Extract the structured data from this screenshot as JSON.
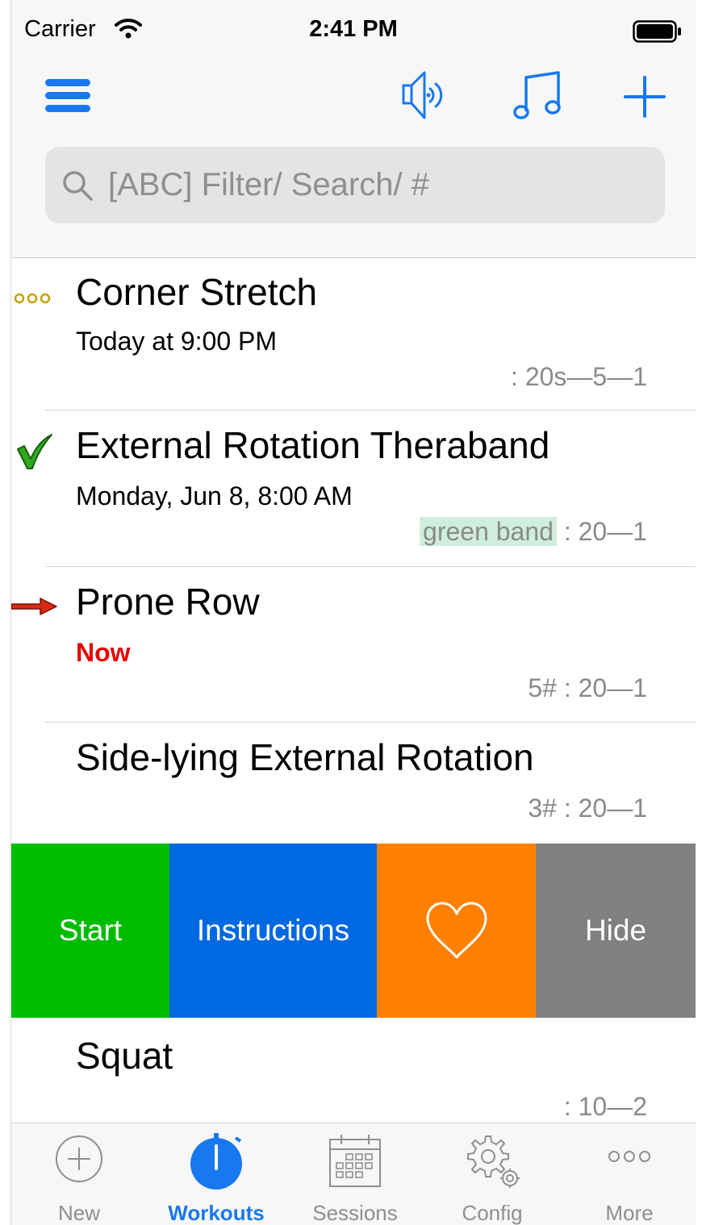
{
  "status_bar": {
    "carrier": "Carrier",
    "time": "2:41 PM"
  },
  "toolbar": {
    "menu_icon": "hamburger-menu-icon",
    "speaker_icon": "speaker-icon",
    "music_icon": "music-note-icon",
    "add_icon": "plus-icon"
  },
  "search": {
    "placeholder": "[ABC] Filter/ Search/ #",
    "value": ""
  },
  "workouts": [
    {
      "title": "Corner Stretch",
      "subtitle": "Today at 9:00 PM",
      "tag": "",
      "meta": ": 20s—5—1",
      "marker": "three-dots-icon"
    },
    {
      "title": "External Rotation Theraband",
      "subtitle": "Monday, Jun 8, 8:00 AM",
      "tag": "green band",
      "meta": " : 20—1",
      "marker": "checkmark-icon"
    },
    {
      "title": "Prone Row",
      "subtitle": "Now",
      "tag": "",
      "meta": "5# : 20—1",
      "marker": "arrow-right-icon"
    },
    {
      "title": "Side-lying External Rotation",
      "subtitle": "",
      "tag": "",
      "meta": "3# : 20—1",
      "marker": ""
    },
    {
      "title": "Squat",
      "subtitle": "",
      "tag": "",
      "meta": ": 10—2",
      "marker": ""
    }
  ],
  "swipe_actions": {
    "start": "Start",
    "instructions": "Instructions",
    "favorite_icon": "heart-icon",
    "hide": "Hide"
  },
  "tabs": [
    {
      "label": "New",
      "icon": "plus-circle-icon",
      "active": false
    },
    {
      "label": "Workouts",
      "icon": "stopwatch-icon",
      "active": true
    },
    {
      "label": "Sessions",
      "icon": "calendar-icon",
      "active": false
    },
    {
      "label": "Config",
      "icon": "gears-icon",
      "active": false
    },
    {
      "label": "More",
      "icon": "more-dots-icon",
      "active": false
    }
  ],
  "colors": {
    "accent": "#1878f0",
    "start": "#00bc00",
    "instructions": "#0068e0",
    "favorite": "#ff8000",
    "hide": "#808080",
    "now": "#e50000",
    "tag_bg": "#cfeedd"
  }
}
